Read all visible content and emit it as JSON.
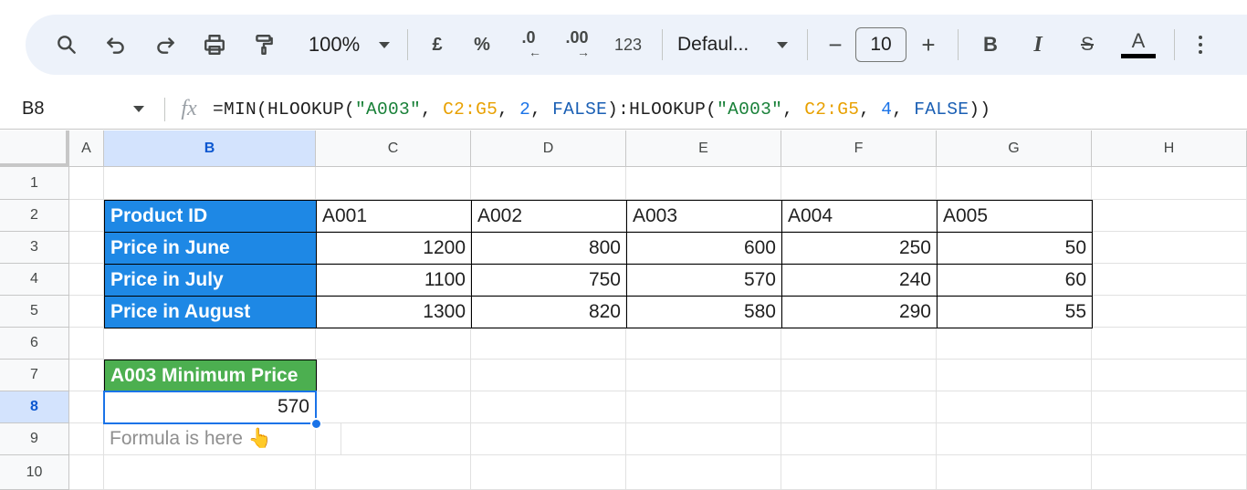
{
  "toolbar": {
    "zoom": "100%",
    "currency": "£",
    "percent": "%",
    "decrease_decimal": ".0",
    "increase_decimal": ".00",
    "number_format": "123",
    "font": "Defaul...",
    "font_size": "10",
    "decrease": "−",
    "increase": "+",
    "bold": "B",
    "italic": "I",
    "strike": "S",
    "text_color": "A"
  },
  "formula_bar": {
    "cell_ref": "B8",
    "fx": "fx",
    "tokens": [
      {
        "t": "=MIN(HLOOKUP(",
        "c": "f-black"
      },
      {
        "t": "\"A003\"",
        "c": "f-str"
      },
      {
        "t": ", ",
        "c": "f-black"
      },
      {
        "t": "C2:G5",
        "c": "f-ref"
      },
      {
        "t": ", ",
        "c": "f-black"
      },
      {
        "t": "2",
        "c": "f-num"
      },
      {
        "t": ", ",
        "c": "f-black"
      },
      {
        "t": "FALSE",
        "c": "f-bool"
      },
      {
        "t": "):HLOOKUP(",
        "c": "f-black"
      },
      {
        "t": "\"A003\"",
        "c": "f-str"
      },
      {
        "t": ", ",
        "c": "f-black"
      },
      {
        "t": "C2:G5",
        "c": "f-ref"
      },
      {
        "t": ", ",
        "c": "f-black"
      },
      {
        "t": "4",
        "c": "f-num"
      },
      {
        "t": ", ",
        "c": "f-black"
      },
      {
        "t": "FALSE",
        "c": "f-bool"
      },
      {
        "t": "))",
        "c": "f-black"
      }
    ]
  },
  "columns": [
    "A",
    "B",
    "C",
    "D",
    "E",
    "F",
    "G",
    "H"
  ],
  "selected_column": "B",
  "rows": [
    "1",
    "2",
    "3",
    "4",
    "5",
    "6",
    "7",
    "8",
    "9",
    "10"
  ],
  "selected_row": "8",
  "table": {
    "row_headers": [
      "Product ID",
      "Price in June",
      "Price in July",
      "Price in August"
    ],
    "product_ids": [
      "A001",
      "A002",
      "A003",
      "A004",
      "A005"
    ],
    "prices": [
      [
        "1200",
        "800",
        "600",
        "250",
        "50"
      ],
      [
        "1100",
        "750",
        "570",
        "240",
        "60"
      ],
      [
        "1300",
        "820",
        "580",
        "290",
        "55"
      ]
    ]
  },
  "result": {
    "label": "A003 Minimum Price",
    "value": "570",
    "note": "Formula is here 👆"
  },
  "colors": {
    "header_blue": "#1e88e5",
    "header_green": "#4caf50",
    "selection": "#1a73e8"
  }
}
